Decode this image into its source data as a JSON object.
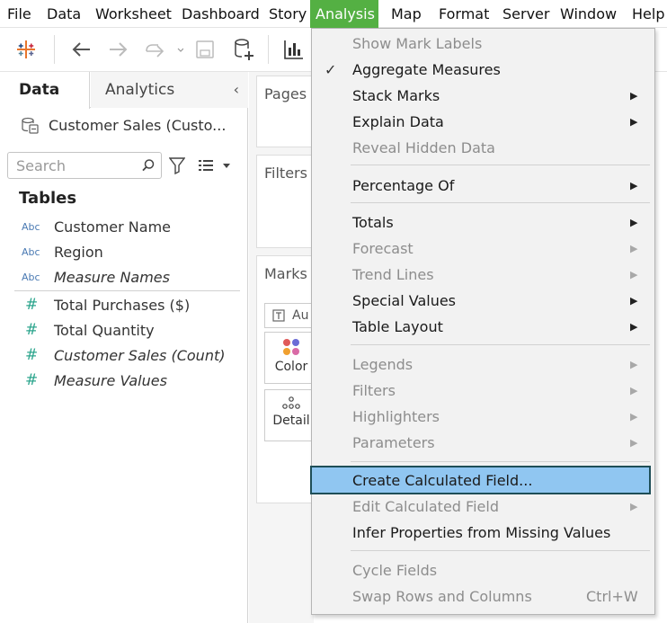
{
  "menubar": {
    "items": [
      {
        "label": "File"
      },
      {
        "label": "Data"
      },
      {
        "label": "Worksheet"
      },
      {
        "label": "Dashboard"
      },
      {
        "label": "Story"
      },
      {
        "label": "Analysis"
      },
      {
        "label": "Map"
      },
      {
        "label": "Format"
      },
      {
        "label": "Server"
      },
      {
        "label": "Window"
      },
      {
        "label": "Help"
      }
    ]
  },
  "toolbar": {
    "icons": [
      "tableau-logo-icon",
      "back-arrow-icon",
      "forward-arrow-icon",
      "redo-icon",
      "save-icon",
      "new-data-source-icon",
      "chart-icon"
    ]
  },
  "left_pane": {
    "tabs": [
      {
        "label": "Data"
      },
      {
        "label": "Analytics"
      }
    ],
    "collapse_glyph": "‹",
    "data_source": "Customer Sales (Custo...",
    "search_placeholder": "Search",
    "tables_heading": "Tables",
    "dimensions": [
      {
        "type": "Abc",
        "label": "Customer Name"
      },
      {
        "type": "Abc",
        "label": "Region"
      },
      {
        "type": "Abc",
        "label": "Measure Names"
      }
    ],
    "measures": [
      {
        "type": "#",
        "label": "Total Purchases ($)"
      },
      {
        "type": "#",
        "label": "Total Quantity"
      },
      {
        "type": "#",
        "label": "Customer Sales (Count)"
      },
      {
        "type": "#",
        "label": "Measure Values"
      }
    ]
  },
  "shelves": {
    "pages": "Pages",
    "filters": "Filters",
    "marks": "Marks",
    "marks_type": "Au",
    "color": "Color",
    "detail": "Detail"
  },
  "analysis_menu": {
    "items": [
      {
        "label": "Show Mark Labels"
      },
      {
        "label": "Aggregate Measures",
        "checked": "✓"
      },
      {
        "label": "Stack Marks"
      },
      {
        "label": "Explain Data"
      },
      {
        "label": "Reveal Hidden Data"
      },
      {
        "label": "Percentage Of"
      },
      {
        "label": "Totals"
      },
      {
        "label": "Forecast"
      },
      {
        "label": "Trend Lines"
      },
      {
        "label": "Special Values"
      },
      {
        "label": "Table Layout"
      },
      {
        "label": "Legends"
      },
      {
        "label": "Filters"
      },
      {
        "label": "Highlighters"
      },
      {
        "label": "Parameters"
      },
      {
        "label": "Create Calculated Field..."
      },
      {
        "label": "Edit Calculated Field"
      },
      {
        "label": "Infer Properties from Missing Values"
      },
      {
        "label": "Cycle Fields"
      },
      {
        "label": "Swap Rows and Columns",
        "shortcut": "Ctrl+W"
      }
    ],
    "submenu_arrow": "▶"
  },
  "colors": {
    "active_menu": "#54b043",
    "highlight": "#90c6f1",
    "highlight_border": "#1e4e57",
    "dimension": "#4a7ab3",
    "measure": "#2ca58d"
  }
}
